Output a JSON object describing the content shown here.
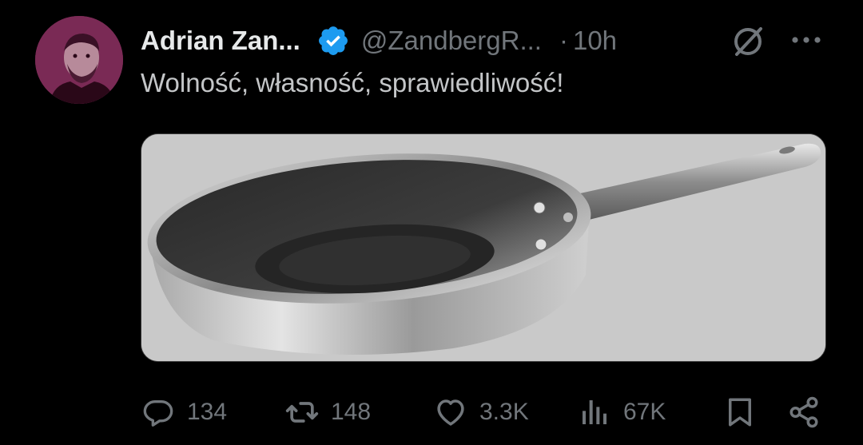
{
  "author": {
    "name": "Adrian Zan...",
    "handle": "@ZandbergR...",
    "separator": "·",
    "time": "10h",
    "verified": true
  },
  "tweet": {
    "text": "Wolność, własność, sprawiedliwość!"
  },
  "media": {
    "icon": "frying-pan-image"
  },
  "actions": {
    "replies": "134",
    "retweets": "148",
    "likes": "3.3K",
    "views": "67K"
  },
  "icons": {
    "grok": "grok-icon",
    "more": "more-icon",
    "reply": "reply-icon",
    "retweet": "retweet-icon",
    "like": "heart-icon",
    "views": "views-icon",
    "bookmark": "bookmark-icon",
    "share": "share-icon",
    "verified": "verified-badge-icon"
  },
  "colors": {
    "background": "#000000",
    "text_primary": "#e7e9ea",
    "text_secondary": "#71767b",
    "verified": "#1d9bf0",
    "avatar_tint": "#7a2a55"
  }
}
